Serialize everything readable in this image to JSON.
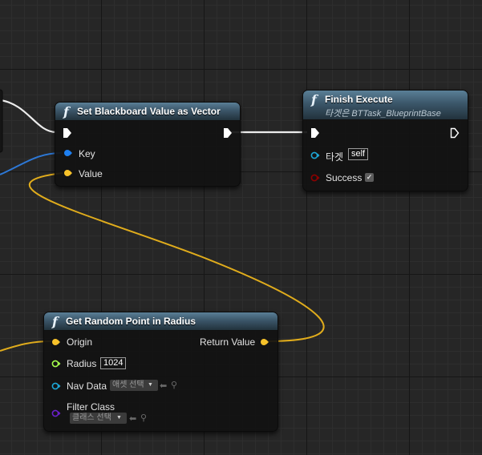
{
  "colors": {
    "exec": "#ffffff",
    "vector_pin": "#f7c22a",
    "name_pin": "#1e7ff0",
    "float_pin": "#a5ff4d",
    "object_pin": "#1da7d7",
    "class_pin": "#6a1fc9",
    "bool_pin": "#8c0000",
    "header": "#3b5669"
  },
  "set_node": {
    "icon": "function-icon",
    "title": "Set Blackboard Value as Vector",
    "pin_key": "Key",
    "pin_value": "Value"
  },
  "finish_node": {
    "icon": "function-icon",
    "title": "Finish Execute",
    "subtitle": "타겟은 BTTask_BlueprintBase",
    "pin_target": "타겟",
    "target_value": "self",
    "pin_success": "Success",
    "success_checked": true
  },
  "random_node": {
    "icon": "function-icon",
    "title": "Get Random Point in Radius",
    "pin_origin": "Origin",
    "pin_return": "Return Value",
    "pin_radius": "Radius",
    "radius_value": "1024",
    "pin_navdata": "Nav Data",
    "navdata_select": "애셋 선택",
    "pin_filter": "Filter Class",
    "filter_select": "클래스 선택"
  }
}
